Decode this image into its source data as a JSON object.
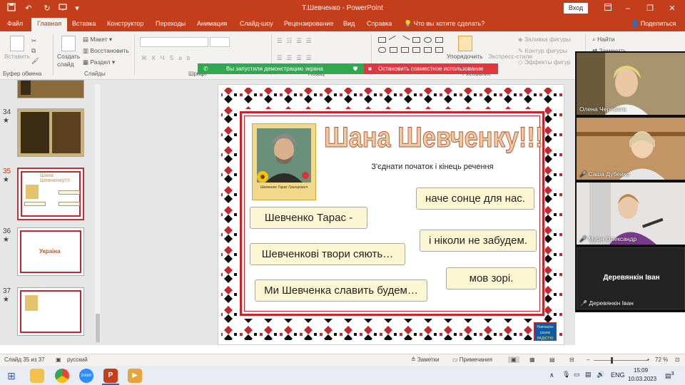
{
  "titlebar": {
    "title": "Т.Шевченко - PowerPoint",
    "signin": "Вход",
    "icons": [
      "save-icon",
      "undo-icon",
      "redo-icon",
      "present-icon"
    ],
    "window_controls": [
      "ribbon-display-icon",
      "minimize-icon",
      "restore-icon",
      "close-icon"
    ]
  },
  "tabs": [
    "Файл",
    "Главная",
    "Вставка",
    "Конструктор",
    "Переходы",
    "Анимация",
    "Слайд-шоу",
    "Рецензирование",
    "Вид",
    "Справка"
  ],
  "active_tab": "Главная",
  "search_hint": "Что вы хотите сделать?",
  "share": "Поделиться",
  "ribbon": {
    "paste": "Вставить",
    "clipboard_group": "Буфер обмена",
    "new_slide": "Создать слайд",
    "layout": "Макет",
    "reset": "Восстановить",
    "section": "Раздел",
    "slides_group": "Слайды",
    "font_group": "Шрифт",
    "paragraph_group": "Абзац",
    "drawing_group": "Рисование",
    "arrange": "Упорядочить",
    "quick_styles": "Экспресс-стили",
    "shape_fill": "Заливка фигуры",
    "shape_outline": "Контур фигуры",
    "shape_effects": "Эффекты фигур",
    "find": "Найти",
    "replace": "Заменить"
  },
  "share_banner": {
    "text": "Вы запустили демонстрацию экрана",
    "stop": "Остановить совместное использование",
    "green": "#2fa84f",
    "red": "#e0383e"
  },
  "thumbnails": [
    {
      "number": "",
      "title": "",
      "selected": false
    },
    {
      "number": "34",
      "title": "",
      "selected": false
    },
    {
      "number": "35",
      "title": "Шана Шевченку!!!",
      "selected": true
    },
    {
      "number": "36",
      "title": "Україна",
      "selected": false
    },
    {
      "number": "37",
      "title": "",
      "selected": false
    }
  ],
  "slide": {
    "title": "Шана Шевченку!!!",
    "subtitle": "З'єднати початок і кінець речення",
    "portrait_caption": "Шевченко Тарас Григорович",
    "badge": "Навчаємо разом РАДІСТЮ",
    "cards_left": [
      "Шевченко Тарас -",
      "Шевченкові твори сяють…",
      "Ми Шевченка славить будем…"
    ],
    "cards_right": [
      "наче сонце для нас.",
      "і ніколи не забудем.",
      "мов зорі."
    ]
  },
  "participants": [
    {
      "name": "Олена Черевата",
      "muted": false
    },
    {
      "name": "Саша Дубейко",
      "muted": true
    },
    {
      "name": "Мусін Олександр",
      "muted": true
    },
    {
      "name": "Деревянкін Іван",
      "muted": true,
      "display": "Деревянкін Іван"
    }
  ],
  "statusbar": {
    "slide_info": "Слайд 35 из 37",
    "language": "русский",
    "notes": "Заметки",
    "comments": "Примечания",
    "zoom": "72 %"
  },
  "taskbar": {
    "apps": [
      "windows-start-icon",
      "file-explorer-icon",
      "chrome-icon",
      "zoom-icon",
      "powerpoint-icon",
      "media-player-icon"
    ],
    "language": "ENG",
    "time": "15:09",
    "date": "10.03.2023",
    "notification_count": "3"
  },
  "colors": {
    "brand": "#c43e1c",
    "slide_red": "#c4262e",
    "card_fill": "#fdf6d3",
    "title_fill": "#f1c99d"
  }
}
